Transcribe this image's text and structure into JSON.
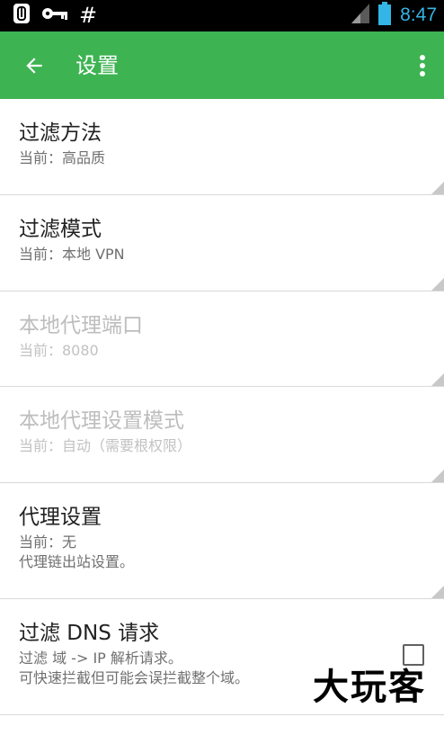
{
  "status_bar": {
    "time": "8:47",
    "hash_glyph": "#",
    "icons": [
      "notification-icon",
      "key-icon",
      "signal-icon",
      "battery-icon"
    ]
  },
  "toolbar": {
    "title": "设置",
    "back_icon": "arrow-back-icon",
    "more_icon": "more-vert-icon"
  },
  "settings": [
    {
      "title": "过滤方法",
      "summary": "当前：高品质",
      "enabled": true
    },
    {
      "title": "过滤模式",
      "summary": "当前：本地 VPN",
      "enabled": true
    },
    {
      "title": "本地代理端口",
      "summary": "当前：8080",
      "enabled": false
    },
    {
      "title": "本地代理设置模式",
      "summary": "当前：自动（需要根权限）",
      "enabled": false
    },
    {
      "title": "代理设置",
      "summary": "当前：无",
      "summary2": "代理链出站设置。",
      "enabled": true
    },
    {
      "title": "过滤 DNS 请求",
      "summary": "过滤 域 -> IP 解析请求。",
      "summary2": "可快速拦截但可能会误拦截整个域。",
      "enabled": true,
      "checked": false
    }
  ],
  "watermark": "大玩客",
  "colors": {
    "toolbar": "#3db351",
    "status_bar": "#000000",
    "time": "#33b5e5"
  }
}
